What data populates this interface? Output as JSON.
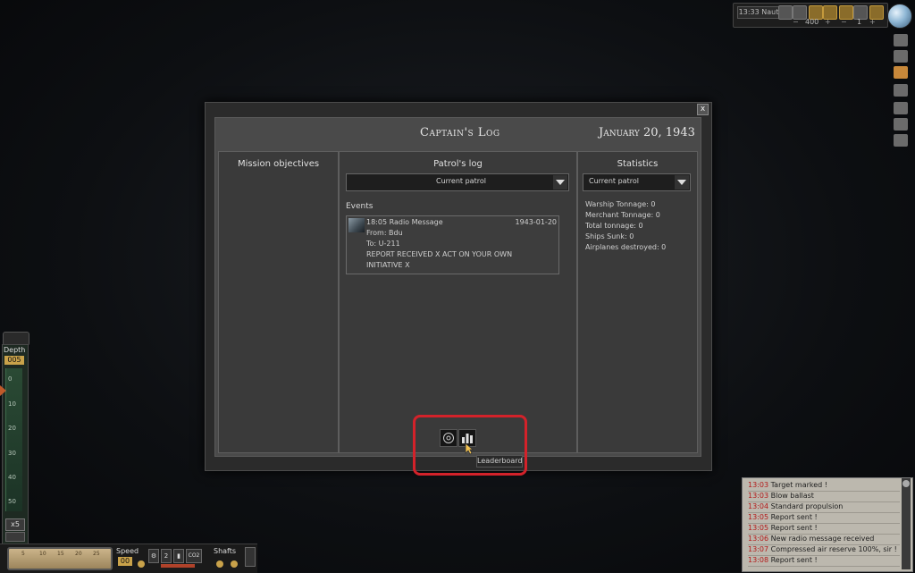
{
  "hud": {
    "time": "13:33 Naut",
    "zoom_value": "400",
    "time_compression": "1"
  },
  "dialog": {
    "title": "Captain's Log",
    "date": "January 20, 1943",
    "close_label": "x"
  },
  "mission": {
    "header": "Mission objectives"
  },
  "patrol": {
    "header": "Patrol's log",
    "dropdown_value": "Current patrol",
    "events_label": "Events",
    "event": {
      "line1": "18:05 Radio Message",
      "date": "1943-01-20",
      "line2": "From: Bdu",
      "line3": "To: U-211",
      "line4": "REPORT RECEIVED X ACT ON YOUR OWN",
      "line5": "INITIATIVE X"
    }
  },
  "statistics": {
    "header": "Statistics",
    "dropdown_value": "Current patrol",
    "lines": [
      "Warship Tonnage: 0",
      "Merchant Tonnage: 0",
      "Total tonnage: 0",
      "Ships Sunk: 0",
      "Airplanes destroyed: 0"
    ]
  },
  "tooltip": "Leaderboard",
  "depth": {
    "label": "Depth",
    "value": "005",
    "ticks": [
      "0",
      "10",
      "20",
      "30",
      "40",
      "50"
    ],
    "zoom": "x5"
  },
  "controls": {
    "speed_label": "Speed",
    "speed_value": "00",
    "gear_label": "2",
    "co2_label": "CO2",
    "shafts_label": "Shafts",
    "compass_ticks": [
      "5",
      "10",
      "15",
      "20",
      "25"
    ]
  },
  "messages": [
    {
      "time": "13:03",
      "text": "Target marked !"
    },
    {
      "time": "13:03",
      "text": "Blow ballast"
    },
    {
      "time": "13:04",
      "text": "Standard propulsion"
    },
    {
      "time": "13:05",
      "text": "Report sent !"
    },
    {
      "time": "13:05",
      "text": "Report sent !"
    },
    {
      "time": "13:06",
      "text": "New radio message received"
    },
    {
      "time": "13:07",
      "text": "Compressed air reserve 100%, sir !"
    },
    {
      "time": "13:08",
      "text": "Report sent !"
    }
  ],
  "colors": {
    "highlight": "#d3222a",
    "gauge_gold": "#c9a24a",
    "message_time": "#b31a1a"
  }
}
